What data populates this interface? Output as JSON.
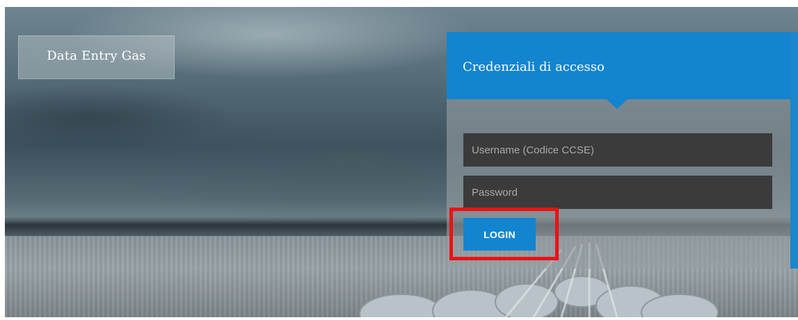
{
  "brand": {
    "title": "Data Entry Gas"
  },
  "login": {
    "title": "Credenziali di accesso",
    "username_placeholder": "Username (Codice CCSE)",
    "username_value": "",
    "password_placeholder": "Password",
    "password_value": "",
    "button_label": "LOGIN"
  },
  "colors": {
    "accent": "#1384cf",
    "input_bg": "#3b3b3b",
    "highlight": "#ee1111"
  }
}
